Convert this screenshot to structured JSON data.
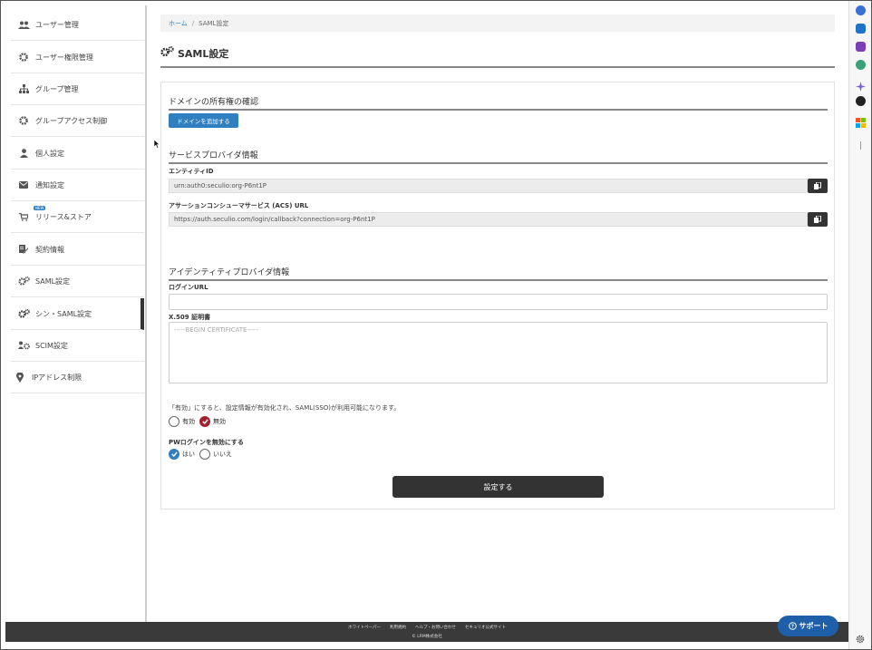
{
  "sidebar": {
    "items": [
      {
        "label": "ユーザー管理",
        "icon": "users-icon"
      },
      {
        "label": "ユーザー権限管理",
        "icon": "gear-icon"
      },
      {
        "label": "グループ管理",
        "icon": "sitemap-icon"
      },
      {
        "label": "グループアクセス制御",
        "icon": "gear-icon"
      },
      {
        "label": "個人設定",
        "icon": "user-icon"
      },
      {
        "label": "通知設定",
        "icon": "envelope-icon"
      },
      {
        "label": "リリース&ストア",
        "icon": "cart-icon",
        "badge": "NEW"
      },
      {
        "label": "契約情報",
        "icon": "contract-icon"
      },
      {
        "label": "SAML設定",
        "icon": "gears-icon"
      },
      {
        "label": "シン・SAML設定",
        "icon": "gears-icon",
        "active": true
      },
      {
        "label": "SCIM設定",
        "icon": "users-gear-icon"
      },
      {
        "label": "IPアドレス制限",
        "icon": "map-marker-icon"
      }
    ]
  },
  "breadcrumb": {
    "home": "ホーム",
    "separator": "/",
    "current": "SAML設定"
  },
  "page": {
    "title": "SAML設定"
  },
  "domain_section": {
    "title": "ドメインの所有権の確認",
    "add_button": "ドメインを追加する"
  },
  "sp_section": {
    "title": "サービスプロバイダ情報",
    "entity_id_label": "エンティティID",
    "entity_id_value": "urn:auth0:seculio:org-P6nt1P",
    "acs_label": "アサーションコンシューマサービス (ACS) URL",
    "acs_value": "https://auth.seculio.com/login/callback?connection=org-P6nt1P"
  },
  "idp_section": {
    "title": "アイデンティティプロバイダ情報",
    "login_url_label": "ログインURL",
    "login_url_value": "",
    "cert_label": "X.509 証明書",
    "cert_placeholder": "-----BEGIN CERTIFICATE-----"
  },
  "enable": {
    "note": "「有効」にすると、設定情報が有効化され、SAML(SSO)が利用可能になります。",
    "options": [
      "有効",
      "無効"
    ],
    "selected": "無効"
  },
  "pw_login": {
    "label": "PWログインを無効にする",
    "options": [
      "はい",
      "いいえ"
    ],
    "selected": "はい"
  },
  "submit_label": "設定する",
  "footer": {
    "links": [
      "ホワイトペーパー",
      "利用規約",
      "ヘルプ・お問い合わせ",
      "セキュリオ公式サイト"
    ],
    "copyright": "© LRM株式会社"
  },
  "support_label": "サポート",
  "colors": {
    "accent_blue": "#2f7fc1",
    "danger_red": "#a3222b",
    "dark": "#333333",
    "support_blue": "#1f5ea8"
  }
}
